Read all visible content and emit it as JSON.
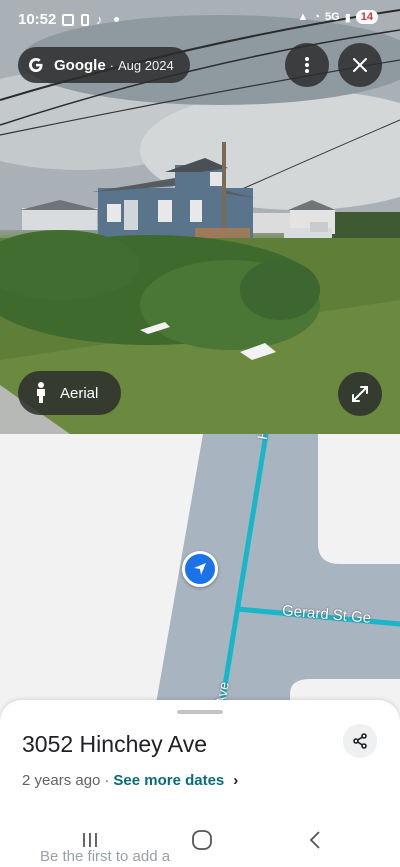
{
  "status_bar": {
    "time": "10:52",
    "network": "5G",
    "battery": "14"
  },
  "streetview": {
    "brand": "Google",
    "separator": "·",
    "capture_date": "Aug 2024",
    "aerial_label": "Aerial",
    "icons": {
      "more": "more-vertical-icon",
      "close": "close-icon",
      "person": "person-icon",
      "expand": "expand-icon"
    }
  },
  "map": {
    "street_main": "Hinchey Ave",
    "street_top_fragment": "Hi",
    "street_side": "Gerard St Ge",
    "street_bottom_fragment": "Ave",
    "colors": {
      "road_fill": "#a8b4c0",
      "route": "#17b6c9",
      "land": "#f2f2f2",
      "marker": "#1a73e8"
    }
  },
  "sheet": {
    "address": "3052 Hinchey Ave",
    "age": "2 years ago",
    "separator": "·",
    "see_more": "See more dates",
    "faded_text": "Be the first to add a"
  },
  "navbar": {
    "icons": [
      "recent-apps-icon",
      "home-icon",
      "back-icon"
    ]
  }
}
